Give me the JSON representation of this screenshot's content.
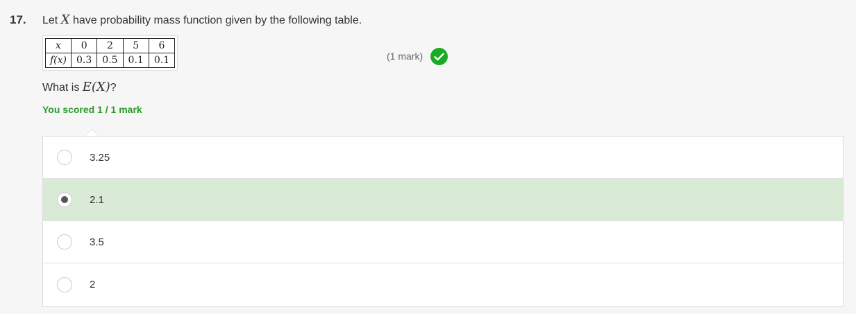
{
  "question": {
    "number": "17.",
    "text_before": "Let ",
    "variable": "X",
    "text_after": " have probability mass function given by the following table.",
    "mark_label": "(1 mark)",
    "prompt_before": "What is ",
    "prompt_math": "E(X)",
    "prompt_after": "?",
    "score": "You scored 1 / 1 mark"
  },
  "pmf_table": {
    "row_x_label": "x",
    "row_f_label": "f(x)",
    "x_values": [
      "0",
      "2",
      "5",
      "6"
    ],
    "f_values": [
      "0.3",
      "0.5",
      "0.1",
      "0.1"
    ]
  },
  "options": [
    {
      "label": "3.25",
      "selected": false
    },
    {
      "label": "2.1",
      "selected": true
    },
    {
      "label": "3.5",
      "selected": false
    },
    {
      "label": "2",
      "selected": false
    }
  ],
  "colors": {
    "correct_green": "#1aaa24",
    "selected_bg": "#d9ead6",
    "score_text": "#2b9a2b"
  },
  "icons": {
    "status": "check-circle-icon"
  }
}
